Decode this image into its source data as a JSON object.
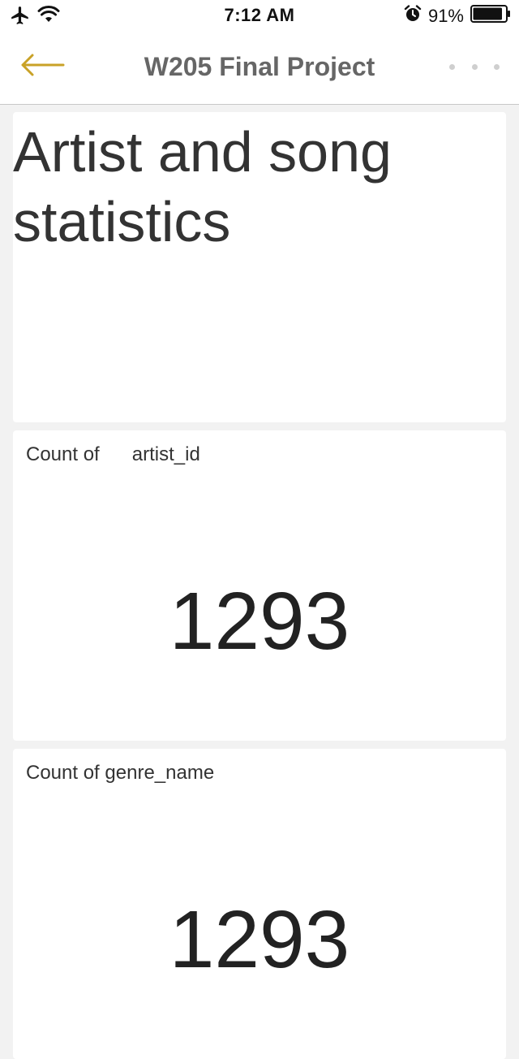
{
  "status_bar": {
    "time": "7:12 AM",
    "battery_percent": "91%",
    "battery_level": 0.91,
    "icons": [
      "airplane-icon",
      "wifi-icon",
      "alarm-icon",
      "battery-icon"
    ]
  },
  "nav": {
    "title": "W205 Final Project",
    "back_icon": "arrow-left-icon",
    "more_icon": "more-horizontal-icon"
  },
  "colors": {
    "accent": "#c9a227",
    "title_gray": "#666666",
    "background": "#f2f2f2",
    "card": "#ffffff"
  },
  "cards": [
    {
      "type": "text",
      "text": "Artist and song statistics"
    },
    {
      "type": "number",
      "label_prefix": "Count of",
      "label_field": "artist_id",
      "value": "1293"
    },
    {
      "type": "number",
      "label_prefix": "Count of",
      "label_field": "genre_name",
      "value": "1293"
    }
  ]
}
